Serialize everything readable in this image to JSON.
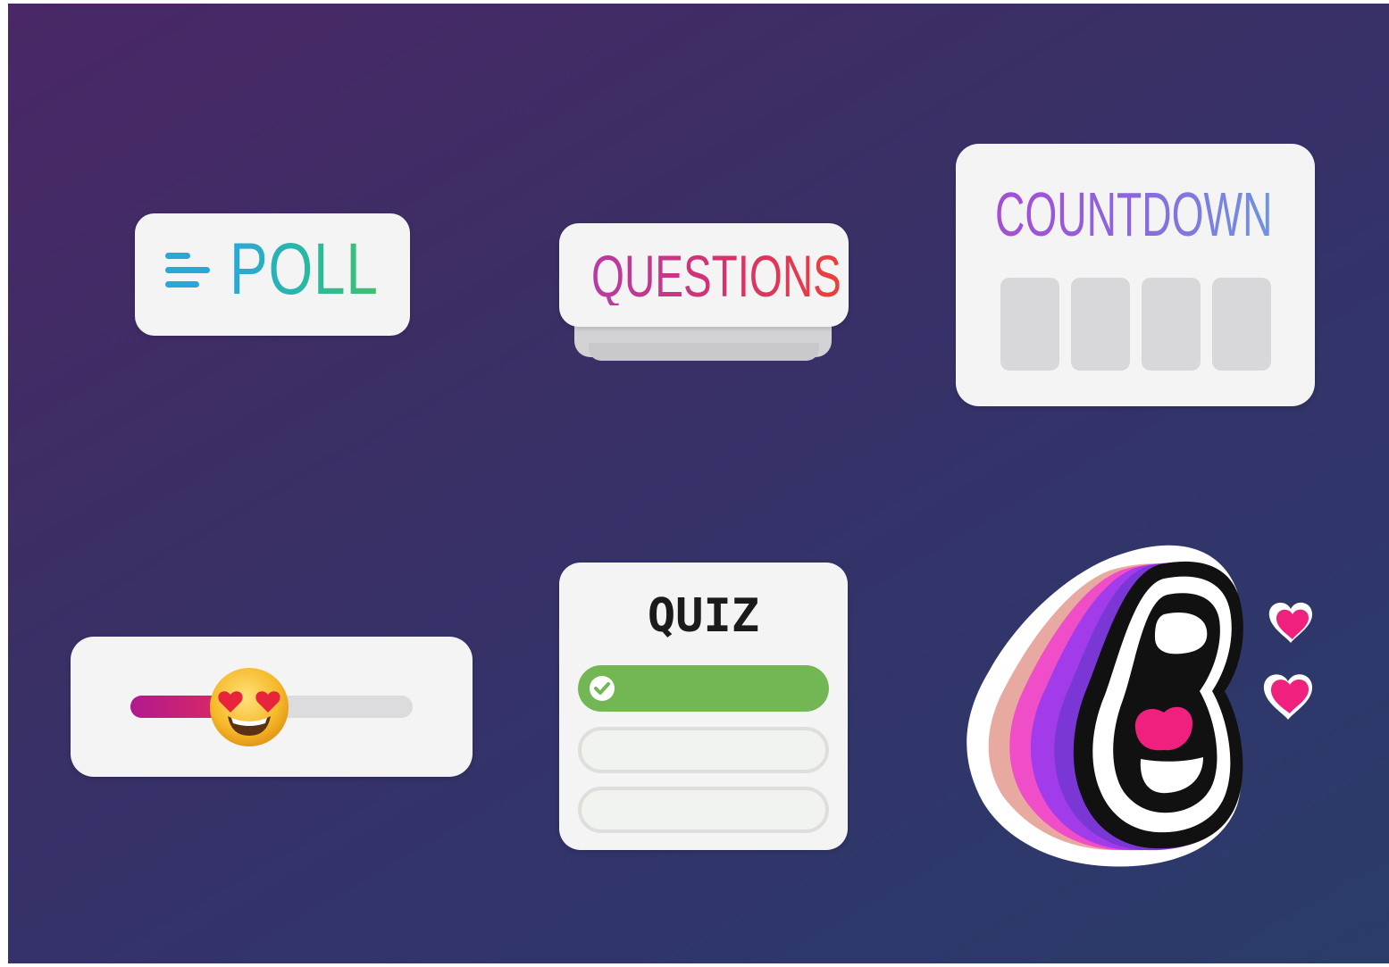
{
  "stickers": {
    "poll": {
      "label": "POLL",
      "icon": "poll-lines-icon"
    },
    "questions": {
      "label": "QUESTIONS"
    },
    "countdown": {
      "label": "COUNTDOWN",
      "digit_boxes": 4
    },
    "emoji_slider": {
      "emoji": "heart-eyes-emoji-icon",
      "value": 0.42
    },
    "quiz": {
      "title": "QUIZ",
      "answers": [
        "correct",
        "empty",
        "empty"
      ]
    },
    "mouth": {
      "icon": "screaming-mouth-icon",
      "accessory": "hearts-icon"
    }
  },
  "colors": {
    "poll_gradient": [
      "#2aa7d9",
      "#3fc26b"
    ],
    "questions_gradient": [
      "#b63ba6",
      "#e8423a"
    ],
    "countdown_gradient": [
      "#a64cd6",
      "#6f93e3"
    ],
    "slider_fill": [
      "#b1198e",
      "#e62c57"
    ],
    "quiz_correct": "#72b754",
    "heart": "#f0207e"
  }
}
